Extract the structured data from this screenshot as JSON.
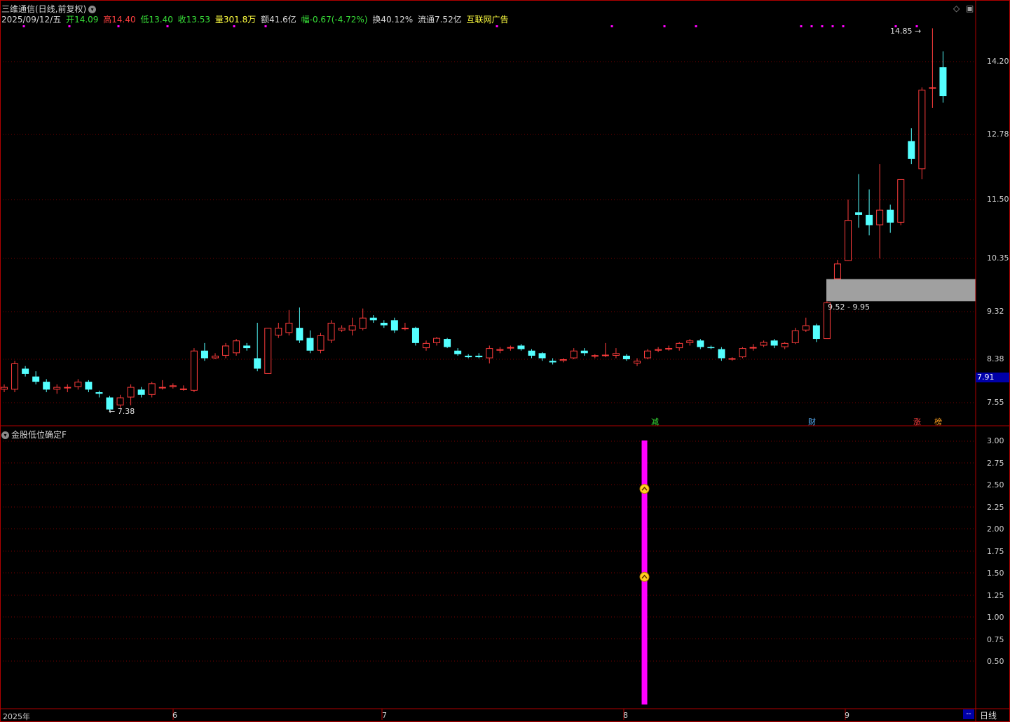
{
  "header": {
    "title": "三维通信(日线,前复权)",
    "date": "2025/09/12/五",
    "open_label": "开",
    "open": "14.09",
    "high_label": "高",
    "high": "14.40",
    "low_label": "低",
    "low": "13.40",
    "close_label": "收",
    "close": "13.53",
    "vol_label": "量",
    "vol": "301.8万",
    "amt_label": "额",
    "amt": "41.6亿",
    "chg_label": "幅",
    "chg": "-0.67(-4.72%)",
    "turn_label": "换",
    "turn": "40.12%",
    "float_label": "流通",
    "float": "7.52亿",
    "industry": "互联网广告"
  },
  "colors": {
    "up": "#ff3c3c",
    "down": "#54ffff",
    "grid": "#7a0000",
    "border": "#b00000",
    "indicator": "#ff00ff",
    "marker": "#ff00ff"
  },
  "price_axis": [
    "14.20",
    "12.78",
    "11.50",
    "10.35",
    "9.32",
    "8.38",
    "7.55"
  ],
  "current_price": "7.91",
  "annotations": {
    "high_label": "14.85",
    "low_label": "7.38",
    "gap_label": "9.52 - 9.95"
  },
  "event_tags": [
    {
      "text": "减",
      "color": "#38e038"
    },
    {
      "text": "财",
      "color": "#5ab4ff"
    },
    {
      "text": "涨",
      "color": "#ff4040"
    },
    {
      "text": "榜",
      "color": "#ffa020"
    }
  ],
  "indicator": {
    "title": "金股低位确定F",
    "axis": [
      "3.00",
      "2.75",
      "2.50",
      "2.25",
      "2.00",
      "1.75",
      "1.50",
      "1.25",
      "1.00",
      "0.75",
      "0.50"
    ]
  },
  "x_axis": [
    "2025年",
    "6",
    "7",
    "8",
    "9"
  ],
  "period": "日线",
  "corner": "--",
  "chart_data": {
    "type": "candlestick",
    "title": "三维通信(日线,前复权)",
    "ylim": [
      7.2,
      14.95
    ],
    "candles": [
      [
        7.8,
        7.85,
        7.75,
        7.9
      ],
      [
        7.8,
        8.3,
        7.75,
        8.35
      ],
      [
        8.2,
        8.1,
        8.05,
        8.25
      ],
      [
        8.05,
        7.95,
        7.9,
        8.15
      ],
      [
        7.95,
        7.8,
        7.75,
        8.0
      ],
      [
        7.8,
        7.85,
        7.72,
        7.9
      ],
      [
        7.85,
        7.85,
        7.75,
        7.9
      ],
      [
        7.85,
        7.95,
        7.8,
        8.0
      ],
      [
        7.95,
        7.8,
        7.75,
        7.98
      ],
      [
        7.75,
        7.72,
        7.65,
        7.78
      ],
      [
        7.65,
        7.42,
        7.38,
        7.68
      ],
      [
        7.5,
        7.65,
        7.45,
        7.7
      ],
      [
        7.65,
        7.85,
        7.5,
        7.9
      ],
      [
        7.8,
        7.7,
        7.65,
        7.85
      ],
      [
        7.7,
        7.92,
        7.65,
        7.95
      ],
      [
        7.85,
        7.85,
        7.8,
        7.98
      ],
      [
        7.85,
        7.88,
        7.82,
        7.92
      ],
      [
        7.82,
        7.82,
        7.78,
        7.88
      ],
      [
        7.78,
        8.55,
        7.75,
        8.6
      ],
      [
        8.55,
        8.4,
        8.35,
        8.7
      ],
      [
        8.4,
        8.45,
        8.38,
        8.5
      ],
      [
        8.45,
        8.65,
        8.4,
        8.7
      ],
      [
        8.5,
        8.75,
        8.45,
        8.78
      ],
      [
        8.65,
        8.6,
        8.55,
        8.7
      ],
      [
        8.4,
        8.2,
        8.15,
        9.1
      ],
      [
        8.1,
        9.0,
        8.1,
        9.0
      ],
      [
        8.85,
        9.0,
        8.8,
        9.1
      ],
      [
        8.9,
        9.1,
        8.85,
        9.35
      ],
      [
        9.0,
        8.75,
        8.7,
        9.4
      ],
      [
        8.8,
        8.55,
        8.5,
        8.95
      ],
      [
        8.55,
        8.85,
        8.5,
        8.9
      ],
      [
        8.75,
        9.1,
        8.7,
        9.15
      ],
      [
        8.95,
        9.0,
        8.92,
        9.05
      ],
      [
        8.95,
        9.05,
        8.85,
        9.2
      ],
      [
        8.98,
        9.2,
        8.95,
        9.38
      ],
      [
        9.2,
        9.15,
        9.1,
        9.25
      ],
      [
        9.1,
        9.05,
        9.0,
        9.15
      ],
      [
        9.15,
        8.95,
        8.9,
        9.2
      ],
      [
        8.98,
        9.0,
        8.95,
        9.1
      ],
      [
        9.0,
        8.7,
        8.65,
        9.02
      ],
      [
        8.6,
        8.7,
        8.55,
        8.75
      ],
      [
        8.7,
        8.8,
        8.65,
        8.82
      ],
      [
        8.78,
        8.62,
        8.6,
        8.8
      ],
      [
        8.55,
        8.48,
        8.45,
        8.6
      ],
      [
        8.45,
        8.42,
        8.4,
        8.48
      ],
      [
        8.45,
        8.42,
        8.4,
        8.5
      ],
      [
        8.4,
        8.6,
        8.3,
        8.65
      ],
      [
        8.55,
        8.58,
        8.5,
        8.62
      ],
      [
        8.6,
        8.62,
        8.55,
        8.65
      ],
      [
        8.65,
        8.58,
        8.55,
        8.68
      ],
      [
        8.55,
        8.45,
        8.4,
        8.58
      ],
      [
        8.5,
        8.4,
        8.35,
        8.52
      ],
      [
        8.35,
        8.32,
        8.28,
        8.4
      ],
      [
        8.35,
        8.38,
        8.32,
        8.4
      ],
      [
        8.4,
        8.55,
        8.38,
        8.6
      ],
      [
        8.55,
        8.5,
        8.45,
        8.6
      ],
      [
        8.45,
        8.46,
        8.4,
        8.48
      ],
      [
        8.45,
        8.47,
        8.42,
        8.7
      ],
      [
        8.45,
        8.5,
        8.4,
        8.6
      ],
      [
        8.45,
        8.38,
        8.35,
        8.48
      ],
      [
        8.3,
        8.35,
        8.25,
        8.4
      ],
      [
        8.4,
        8.55,
        8.38,
        8.58
      ],
      [
        8.55,
        8.58,
        8.52,
        8.62
      ],
      [
        8.58,
        8.6,
        8.55,
        8.65
      ],
      [
        8.6,
        8.7,
        8.55,
        8.72
      ],
      [
        8.7,
        8.75,
        8.65,
        8.78
      ],
      [
        8.75,
        8.62,
        8.58,
        8.78
      ],
      [
        8.62,
        8.6,
        8.58,
        8.65
      ],
      [
        8.58,
        8.4,
        8.35,
        8.62
      ],
      [
        8.38,
        8.4,
        8.35,
        8.42
      ],
      [
        8.42,
        8.6,
        8.4,
        8.62
      ],
      [
        8.62,
        8.62,
        8.55,
        8.68
      ],
      [
        8.65,
        8.72,
        8.62,
        8.75
      ],
      [
        8.75,
        8.65,
        8.6,
        8.78
      ],
      [
        8.62,
        8.7,
        8.58,
        8.72
      ],
      [
        8.7,
        8.95,
        8.68,
        9.0
      ],
      [
        8.95,
        9.05,
        8.92,
        9.2
      ],
      [
        9.05,
        8.78,
        8.72,
        9.08
      ],
      [
        8.78,
        9.5,
        8.78,
        9.52
      ],
      [
        9.95,
        10.25,
        9.95,
        10.32
      ],
      [
        10.3,
        11.1,
        10.3,
        11.5
      ],
      [
        11.25,
        11.2,
        10.95,
        12.0
      ],
      [
        11.2,
        11.0,
        10.8,
        11.7
      ],
      [
        11.0,
        11.3,
        10.35,
        12.2
      ],
      [
        11.3,
        11.05,
        10.85,
        11.4
      ],
      [
        11.05,
        11.9,
        11.0,
        11.9
      ],
      [
        12.65,
        12.3,
        12.2,
        12.9
      ],
      [
        12.1,
        13.65,
        11.9,
        13.7
      ],
      [
        13.7,
        13.7,
        13.3,
        14.85
      ],
      [
        14.09,
        13.53,
        13.4,
        14.4
      ]
    ],
    "volume_signal": {
      "type": "bar",
      "value": 3.0,
      "markers": [
        2.45,
        1.45
      ]
    }
  }
}
